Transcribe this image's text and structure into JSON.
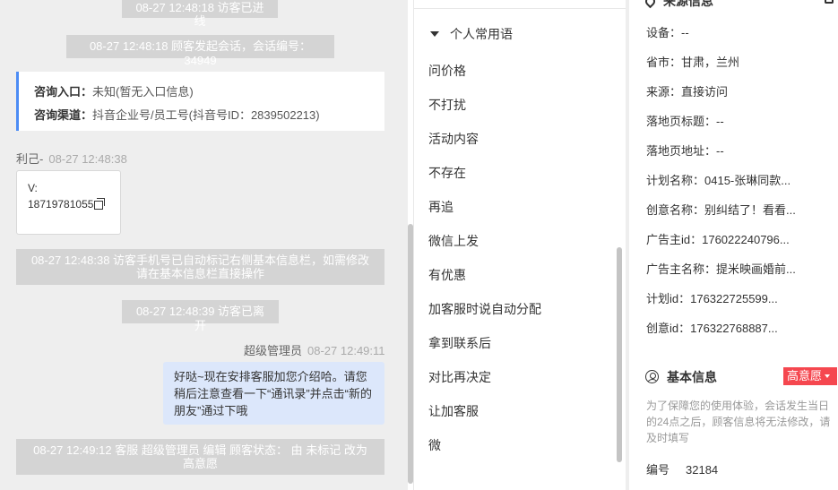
{
  "chat": {
    "sys_entered": "08-27 12:48:18 访客已进线",
    "sys_session": "08-27 12:48:18 顾客发起会话，会话编号：34949",
    "card": {
      "entry_label": "咨询入口：",
      "entry_value": "未知(暂无入口信息)",
      "channel_label": "咨询渠道：",
      "channel_value": "抖音企业号/员工号(抖音号ID：2839502213)"
    },
    "customer_name": "利己-",
    "customer_time": "08-27 12:48:38",
    "customer_msg_line1": "V:",
    "customer_msg_line2": "18719781055",
    "sys_phone": "08-27 12:48:38 访客手机号已自动标记右侧基本信息栏，如需修改请在基本信息栏直接操作",
    "sys_left": "08-27 12:48:39 访客已离开",
    "agent_name": "超级管理员",
    "agent_time": "08-27 12:49:11",
    "agent_msg": "好哒~现在安排客服加您介绍哈。请您稍后注意查看一下“通讯录”并点击“新的朋友”通过下哦",
    "sys_status": "08-27 12:49:12 客服 超级管理员 编辑 顾客状态： 由 未标记 改为 高意愿"
  },
  "phrases": {
    "header": "个人常用语",
    "items": [
      "问价格",
      "不打扰",
      "活动内容",
      "不存在",
      "再追",
      "微信上发",
      "有优惠",
      "加客服时说自动分配",
      "拿到联系后",
      "对比再决定",
      "让加客服",
      "微"
    ]
  },
  "info": {
    "source_title": "来源信息",
    "fields": [
      "设备：--",
      "省市：甘肃，兰州",
      "来源：直接访问",
      "落地页标题：--",
      "落地页地址：--",
      "计划名称：0415-张琳同款...",
      "创意名称：别纠结了！看看...",
      "广告主id：176022240796...",
      "广告主名称：提米映画婚前...",
      "计划id：176322725599...",
      "创意id：176322768887..."
    ],
    "basic_title": "基本信息",
    "intent_badge": "高意愿",
    "notice": "为了保障您的使用体验，会话发生当日的24点之后，顾客信息将无法修改，请及时填写",
    "serial_label": "编号",
    "serial_value": "32184"
  }
}
